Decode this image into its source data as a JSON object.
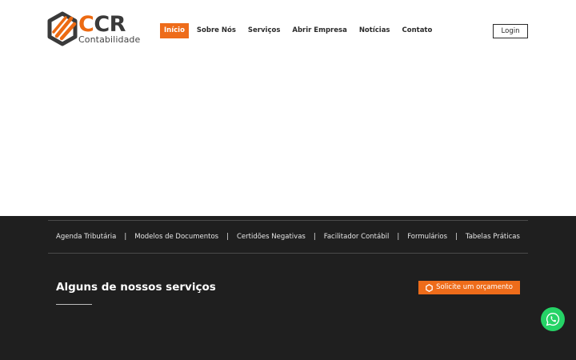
{
  "brand": {
    "name_main": "CCR",
    "name_sub": "Contabilidade",
    "accent_color": "#ee6c1a",
    "dark_color": "#3a3a3a"
  },
  "nav": {
    "items": [
      {
        "label": "Início",
        "active": true
      },
      {
        "label": "Sobre Nós",
        "active": false
      },
      {
        "label": "Serviços",
        "active": false
      },
      {
        "label": "Abrir Empresa",
        "active": false
      },
      {
        "label": "Notícias",
        "active": false
      },
      {
        "label": "Contato",
        "active": false
      }
    ],
    "login_label": "Login"
  },
  "quick_links": {
    "items": [
      "Agenda Tributária",
      "Modelos de Documentos",
      "Certidões Negativas",
      "Facilitador Contábil",
      "Formulários",
      "Tabelas Práticas"
    ],
    "separator": "|"
  },
  "services": {
    "title": "Alguns de nossos serviços",
    "quote_button_label": "Solicite um orçamento",
    "quote_icon": "hexagon-icon"
  },
  "floating": {
    "whatsapp_icon": "whatsapp-icon",
    "whatsapp_color": "#25d366"
  },
  "colors": {
    "dark_background": "#1f1f1f",
    "header_background": "#ffffff"
  }
}
